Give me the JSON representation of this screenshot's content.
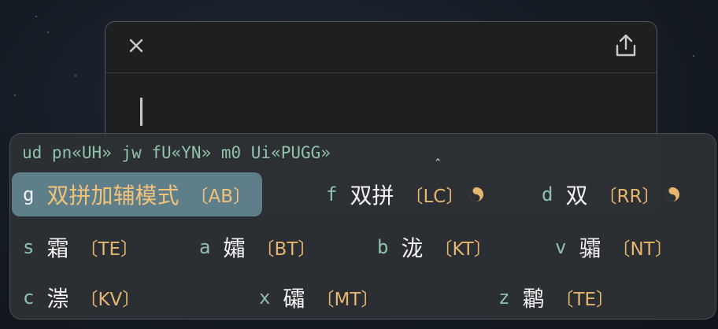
{
  "toolbar": {
    "close_icon": "close-icon",
    "share_icon": "share-icon"
  },
  "ime": {
    "preedit": "ud pn«UH» jw fU«YN» m0 Ui«PUGG»",
    "caret_glyph": "ˆ",
    "candidates": [
      {
        "label": "g",
        "text": "双拼加辅模式",
        "comment": "〔AB〕",
        "highlighted": true
      },
      {
        "label": "f",
        "text": "双拼",
        "comment": "〔LC〕",
        "icon": "yin-yang-icon"
      },
      {
        "label": "d",
        "text": "双",
        "comment": "〔RR〕",
        "icon": "yin-yang-icon"
      },
      {
        "label": "s",
        "text": "霜",
        "comment": "〔TE〕"
      },
      {
        "label": "a",
        "text": "孀",
        "comment": "〔BT〕"
      },
      {
        "label": "b",
        "text": "泷",
        "comment": "〔KT〕"
      },
      {
        "label": "v",
        "text": "骦",
        "comment": "〔NT〕"
      },
      {
        "label": "c",
        "text": "漴",
        "comment": "〔KV〕"
      },
      {
        "label": "x",
        "text": "礵",
        "comment": "〔MT〕"
      },
      {
        "label": "z",
        "text": "鹴",
        "comment": "〔TE〕"
      }
    ]
  },
  "colors": {
    "preedit": "#8fc2a9",
    "comment": "#e6b56e",
    "highlight_bg": "#5e7f89",
    "highlight_text": "#f1c27a"
  }
}
